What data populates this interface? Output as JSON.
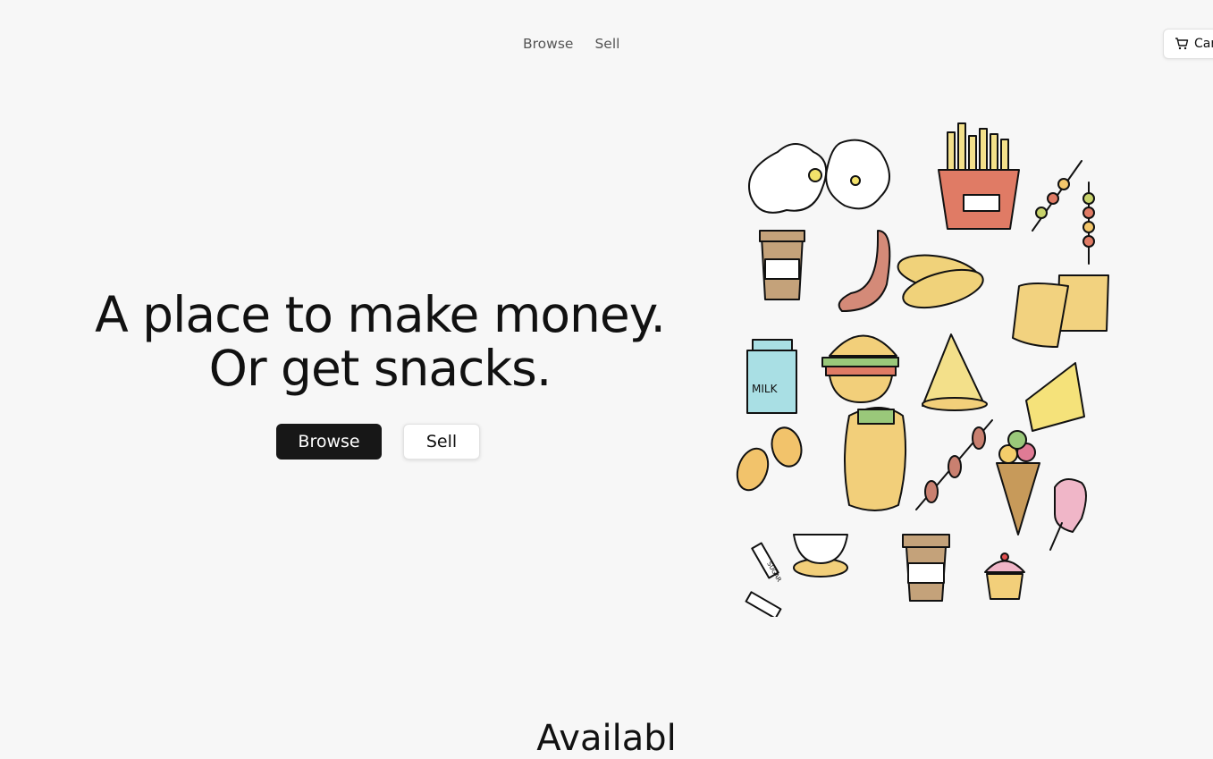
{
  "nav": {
    "links": [
      "Browse",
      "Sell"
    ],
    "cart_label": "Car"
  },
  "hero": {
    "title_line1": "A place to make money.",
    "title_line2": "Or get snacks.",
    "browse_button": "Browse",
    "sell_button": "Sell",
    "illustration_labels": {
      "milk": "MILK",
      "sugar": "SUGAR"
    }
  },
  "section": {
    "heading_visible": "Availabl"
  }
}
